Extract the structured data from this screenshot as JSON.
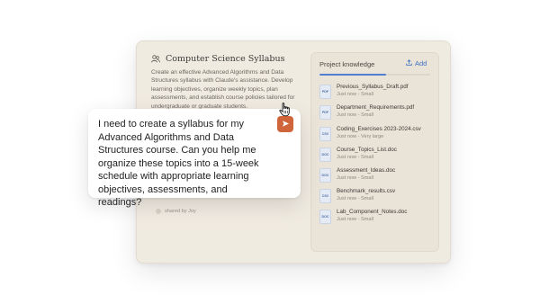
{
  "project": {
    "title": "Computer Science Syllabus",
    "description": "Create an effective Advanced Algorithms and Data Structures syllabus with Claude's assistance. Develop learning objectives, organize weekly topics, plan assessments, and establish course policies tailored for undergraduate or graduate students.",
    "shared_by": "shared by Joy"
  },
  "chat": {
    "message": "I need to create a syllabus for my Advanced Algorithms and Data Structures course. Can you help me organize these topics into a 15-week schedule with appropriate learning objectives, assessments, and readings?"
  },
  "knowledge": {
    "title": "Project knowledge",
    "add_label": "Add",
    "progress_fraction": 0.6,
    "files": [
      {
        "name": "Previous_Syllabus_Draft.pdf",
        "meta": "Just now - Small",
        "type": "PDF"
      },
      {
        "name": "Department_Requirements.pdf",
        "meta": "Just now - Small",
        "type": "PDF"
      },
      {
        "name": "Coding_Exercises 2023-2024.csv",
        "meta": "Just now - Very large",
        "type": "CSV"
      },
      {
        "name": "Course_Topics_List.doc",
        "meta": "Just now - Small",
        "type": "DOC"
      },
      {
        "name": "Assessment_Ideas.doc",
        "meta": "Just now - Small",
        "type": "DOC"
      },
      {
        "name": "Benchmark_results.csv",
        "meta": "Just now - Small",
        "type": "CSV"
      },
      {
        "name": "Lab_Component_Notes.doc",
        "meta": "Just now - Small",
        "type": "DOC"
      }
    ]
  },
  "colors": {
    "accent": "#d0643a",
    "link": "#3c6fc2",
    "card_bg": "#f0ebe1"
  }
}
